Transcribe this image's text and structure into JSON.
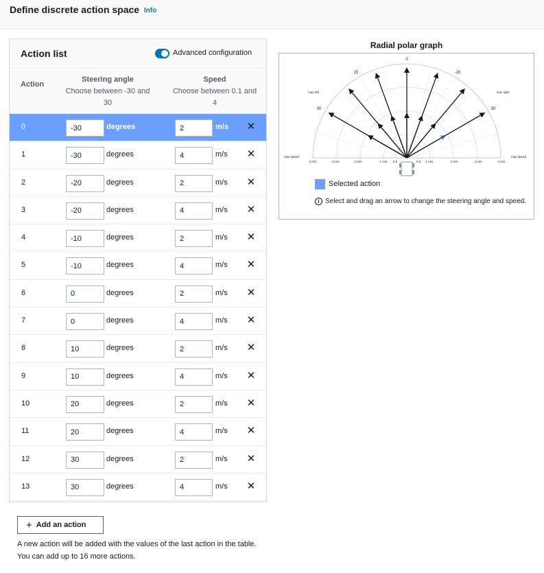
{
  "header": {
    "title": "Define discrete action space",
    "info": "Info"
  },
  "panel": {
    "title": "Action list",
    "toggle_label": "Advanced configuration",
    "col_action": "Action",
    "col_steer": "Steering angle",
    "col_steer_hint": "Choose between -30 and 30",
    "col_speed": "Speed",
    "col_speed_hint": "Choose between 0.1 and 4",
    "unit_deg": "degrees",
    "unit_ms": "m/s",
    "rows": [
      {
        "idx": "0",
        "steer": "-30",
        "speed": "2",
        "selected": true
      },
      {
        "idx": "1",
        "steer": "-30",
        "speed": "4"
      },
      {
        "idx": "2",
        "steer": "-20",
        "speed": "2"
      },
      {
        "idx": "3",
        "steer": "-20",
        "speed": "4"
      },
      {
        "idx": "4",
        "steer": "-10",
        "speed": "2"
      },
      {
        "idx": "5",
        "steer": "-10",
        "speed": "4"
      },
      {
        "idx": "6",
        "steer": "0",
        "speed": "2"
      },
      {
        "idx": "7",
        "steer": "0",
        "speed": "4"
      },
      {
        "idx": "8",
        "steer": "10",
        "speed": "2"
      },
      {
        "idx": "9",
        "steer": "10",
        "speed": "4"
      },
      {
        "idx": "10",
        "steer": "20",
        "speed": "2"
      },
      {
        "idx": "11",
        "steer": "20",
        "speed": "4"
      },
      {
        "idx": "12",
        "steer": "30",
        "speed": "2"
      },
      {
        "idx": "13",
        "steer": "30",
        "speed": "4"
      }
    ]
  },
  "add_action": {
    "label": "Add an action",
    "note": "A new action will be added with the values of the last action in the table. You can add up to 16 more actions."
  },
  "graph": {
    "title": "Radial polar graph",
    "legend": "Selected action",
    "hint": "Select and drag an arrow to change the steering angle and speed.",
    "labels": {
      "deg0": "0",
      "deg15": "15",
      "degm15": "-15",
      "deg30": "30",
      "degm30": "30",
      "max_left": "max left",
      "max_right": "max right",
      "max_speed": "max speed",
      "l4": "4 m/s",
      "l3": "3 m/s",
      "l2": "2 m/s",
      "l1": "1 m/s",
      "l05": "0.5",
      "r05": "0.5",
      "r1": "1 m/s",
      "r2": "2 m/s",
      "r3": "3 m/s",
      "r4": "4 m/s"
    }
  },
  "colors": {
    "accent": "#0073bb",
    "selected": "#6b9eff"
  }
}
